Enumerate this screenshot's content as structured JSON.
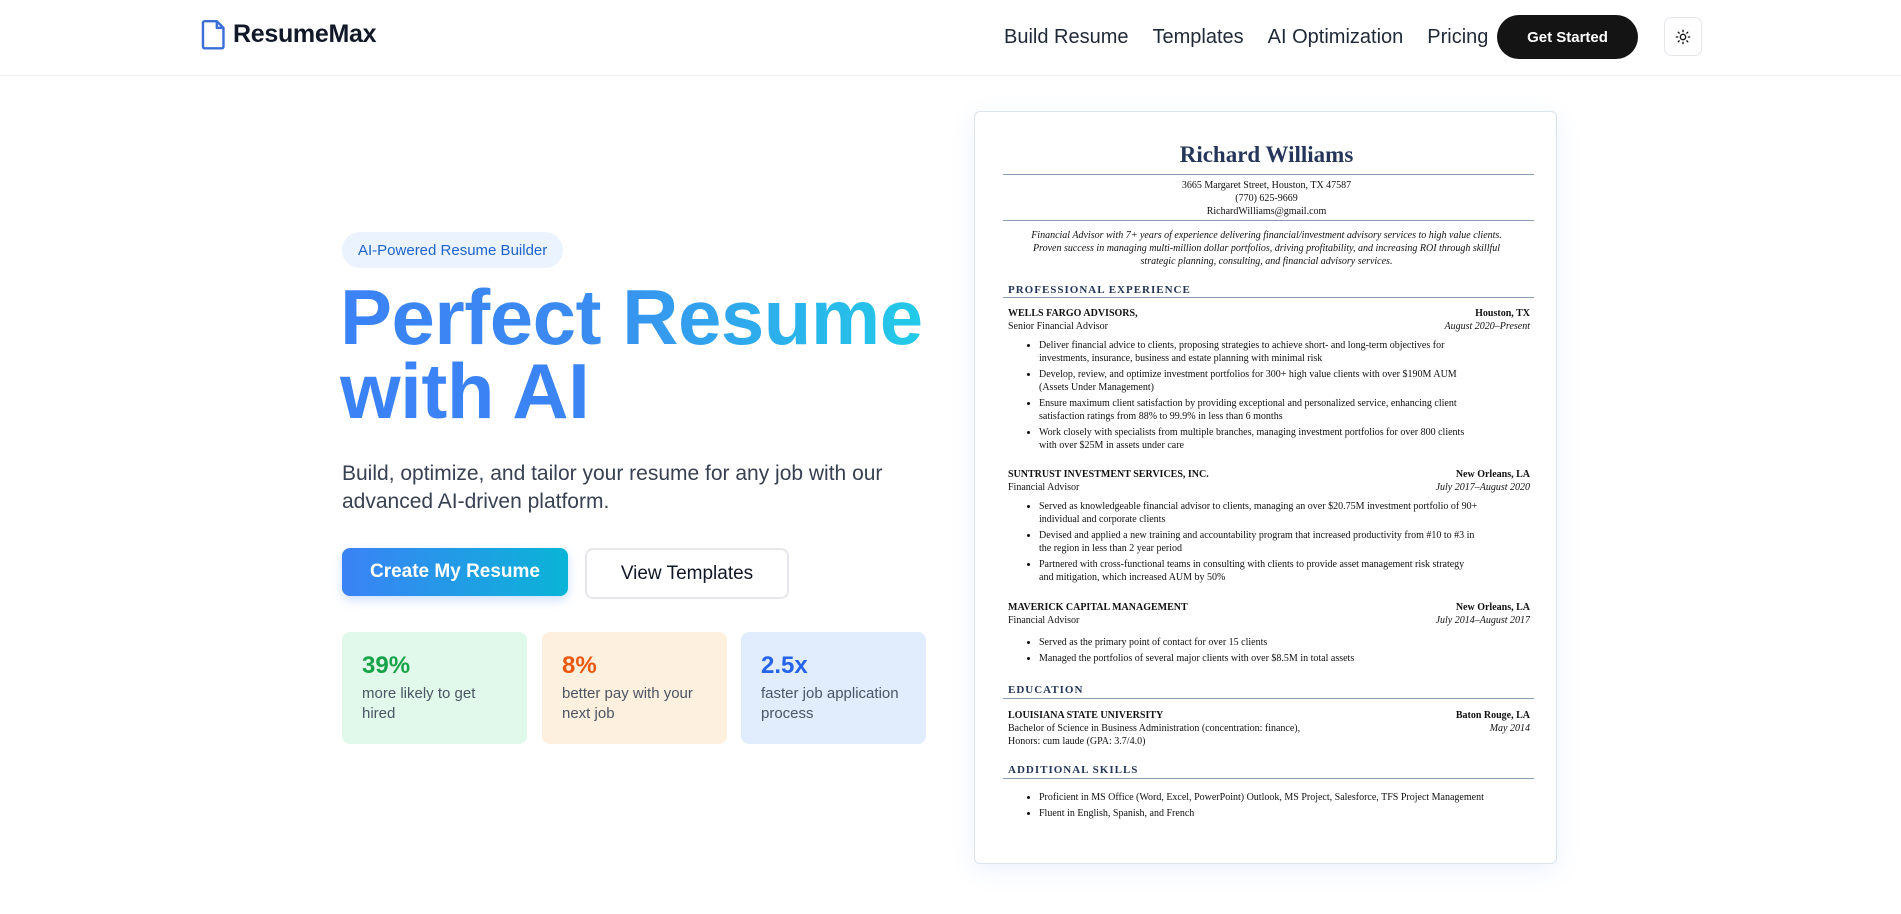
{
  "nav": {
    "brand": "ResumeMax",
    "links": [
      "Build Resume",
      "Templates",
      "AI Optimization",
      "Pricing"
    ],
    "cta": "Get Started"
  },
  "hero": {
    "badge": "AI-Powered Resume Builder",
    "title_line1": "Perfect Resume",
    "title_line2": "with AI",
    "subtitle": "Build, optimize, and tailor your resume for any job with our advanced AI-driven platform.",
    "primary_button": "Create My Resume",
    "secondary_button": "View Templates"
  },
  "stats": [
    {
      "value": "39%",
      "label": "more likely to get hired",
      "color": "#16a34a"
    },
    {
      "value": "8%",
      "label": "better pay with your next job",
      "color": "#ea580c"
    },
    {
      "value": "2.5x",
      "label": "faster job application process",
      "color": "#2563eb"
    }
  ],
  "resume": {
    "name": "Richard Williams",
    "address": "3665 Margaret Street, Houston, TX 47587",
    "phone": "(770) 625-9669",
    "email": "RichardWilliams@gmail.com",
    "summary": "Financial Advisor with 7+ years of experience delivering financial/investment advisory services to high value clients. Proven success in managing multi-million dollar portfolios, driving profitability, and increasing ROI through skillful strategic planning, consulting, and financial advisory services.",
    "experience_heading": "PROFESSIONAL EXPERIENCE",
    "jobs": [
      {
        "company": "WELLS FARGO ADVISORS,",
        "location": "Houston, TX",
        "title": "Senior Financial Advisor",
        "dates": "August 2020–Present",
        "bullets": [
          "Deliver financial advice to clients, proposing strategies to achieve short- and long-term objectives for investments, insurance, business and estate planning with minimal risk",
          "Develop, review, and optimize investment portfolios for 300+ high value clients with over $190M AUM (Assets Under Management)",
          "Ensure maximum client satisfaction by providing exceptional and personalized service, enhancing client satisfaction ratings from 88% to 99.9% in less than 6 months",
          "Work closely with specialists from multiple branches, managing investment portfolios for over 800 clients with over $25M in assets under care"
        ]
      },
      {
        "company": "SUNTRUST INVESTMENT SERVICES, INC.",
        "location": "New Orleans, LA",
        "title": "Financial Advisor",
        "dates": "July 2017–August 2020",
        "bullets": [
          "Served as knowledgeable financial advisor to clients, managing an over $20.75M investment portfolio of 90+ individual and corporate clients",
          "Devised and applied a new training and accountability program that increased productivity from #10 to #3 in the region in less than 2 year period",
          "Partnered with cross-functional teams in consulting with clients to provide asset management risk strategy and mitigation, which increased AUM by 50%"
        ]
      },
      {
        "company": "MAVERICK CAPITAL MANAGEMENT",
        "location": "New Orleans, LA",
        "title": "Financial Advisor",
        "dates": "July 2014–August 2017",
        "bullets": [
          "Served as the primary point of contact for over 15 clients",
          "Managed the portfolios of several major clients with over $8.5M in total assets"
        ]
      }
    ],
    "education_heading": "EDUCATION",
    "education": {
      "school": "LOUISIANA STATE UNIVERSITY",
      "location": "Baton Rouge, LA",
      "degree": "Bachelor of Science in Business Administration (concentration: finance),",
      "date": "May 2014",
      "honors": "Honors: cum laude (GPA: 3.7/4.0)"
    },
    "skills_heading": "ADDITIONAL SKILLS",
    "skills": [
      "Proficient in MS Office (Word, Excel, PowerPoint) Outlook, MS Project, Salesforce, TFS Project Management",
      "Fluent in English, Spanish, and French"
    ]
  }
}
